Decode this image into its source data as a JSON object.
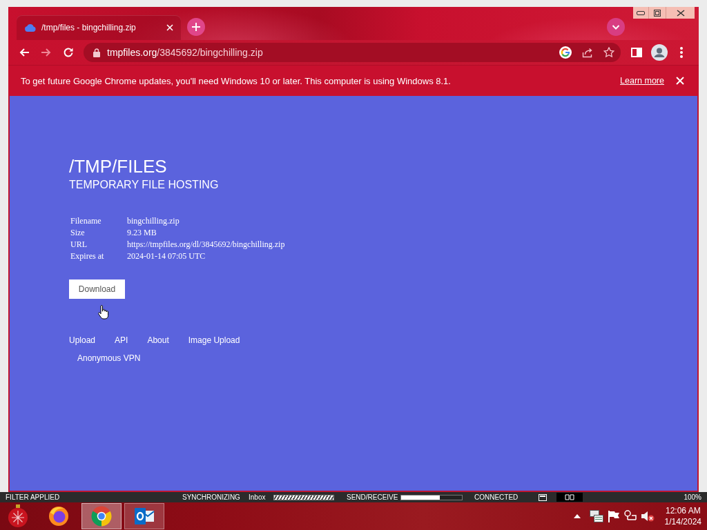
{
  "tabs": [
    {
      "title": "/tmp/files - bingchilling.zip",
      "selected": true
    }
  ],
  "toolbar": {
    "nav_buttons": [
      {
        "kind": "back",
        "disabled": false
      },
      {
        "kind": "forward",
        "disabled": true
      },
      {
        "kind": "reload",
        "disabled": false
      }
    ],
    "address": {
      "host": "tmpfiles.org",
      "path": "/3845692/bingchilling.zip"
    }
  },
  "infobar": {
    "message": "To get future Google Chrome updates, you'll need Windows 10 or later. This computer is using Windows 8.1.",
    "link": "Learn more"
  },
  "page": {
    "title": "/TMP/FILES",
    "subtitle": "TEMPORARY FILE HOSTING",
    "details": [
      {
        "label": "Filename",
        "value": "bingchilling.zip"
      },
      {
        "label": "Size",
        "value": "9.23 MB"
      },
      {
        "label": "URL",
        "value": "https://tmpfiles.org/dl/3845692/bingchilling.zip"
      },
      {
        "label": "Expires at",
        "value": "2024-01-14 07:05 UTC"
      }
    ],
    "download_button": "Download",
    "links": [
      "Upload",
      "API",
      "About",
      "Image Upload",
      "Anonymous VPN"
    ]
  },
  "status_bar": [
    {
      "kind": "text",
      "text": "FILTER APPLIED"
    },
    {
      "kind": "text",
      "text": "SYNCHRONIZING"
    },
    {
      "kind": "text",
      "text": "Inbox"
    },
    {
      "kind": "busy"
    },
    {
      "kind": "text",
      "text": "SEND/RECEIVE"
    },
    {
      "kind": "progress",
      "level": 0.64
    },
    {
      "kind": "text",
      "text": "CONNECTED"
    },
    {
      "kind": "view_buttons"
    },
    {
      "kind": "text",
      "text": "100%"
    }
  ],
  "taskbar": {
    "apps": [
      {
        "kind": "ornament",
        "open": false,
        "selected": false
      },
      {
        "kind": "firefox",
        "open": false,
        "selected": false
      },
      {
        "kind": "chrome",
        "open": true,
        "selected": true
      },
      {
        "kind": "outlook",
        "open": true,
        "selected": false
      }
    ],
    "clock": {
      "time": "12:06 AM",
      "date": "1/14/2024"
    }
  }
}
